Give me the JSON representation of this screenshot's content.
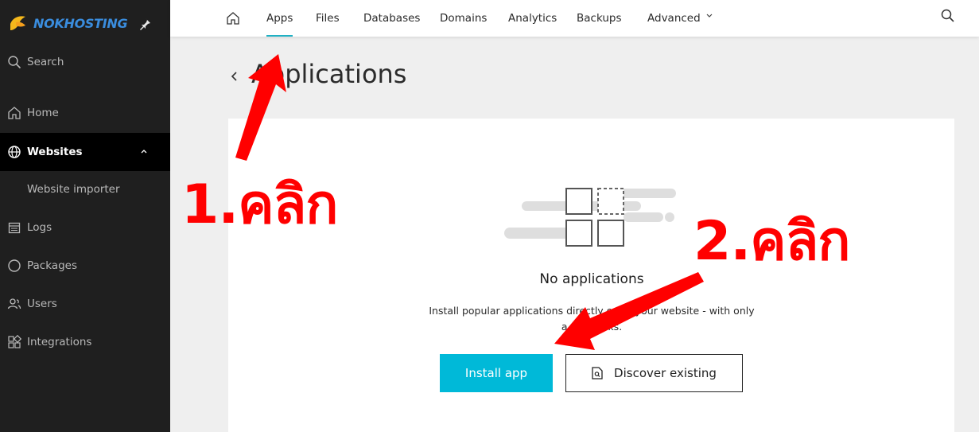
{
  "brand": {
    "name": "NOKHOSTING",
    "color": "#3a8dde"
  },
  "sidebar": {
    "items": [
      {
        "label": "Search",
        "icon": "search-icon"
      },
      {
        "label": "Home",
        "icon": "home-icon"
      },
      {
        "label": "Websites",
        "icon": "globe-icon",
        "active": true
      },
      {
        "label": "Website importer",
        "icon": ""
      },
      {
        "label": "Logs",
        "icon": "calendar-icon"
      },
      {
        "label": "Packages",
        "icon": "circle-icon"
      },
      {
        "label": "Users",
        "icon": "users-icon"
      },
      {
        "label": "Integrations",
        "icon": "grid-icon"
      }
    ]
  },
  "topnav": {
    "tabs": [
      {
        "label": "Apps",
        "active": true
      },
      {
        "label": "Files"
      },
      {
        "label": "Databases"
      },
      {
        "label": "Domains"
      },
      {
        "label": "Analytics"
      },
      {
        "label": "Backups"
      },
      {
        "label": "Advanced"
      }
    ],
    "accent": "#20b1c4"
  },
  "page": {
    "title": "Applications",
    "empty_title": "No applications",
    "empty_desc": "Install popular applications directly on to your website - with only a few clicks.",
    "install_label": "Install app",
    "discover_label": "Discover existing",
    "primary_color": "#00b9d8"
  },
  "annotations": {
    "step1": "1.คลิก",
    "step2": "2.คลิก",
    "color": "#ff0000"
  }
}
